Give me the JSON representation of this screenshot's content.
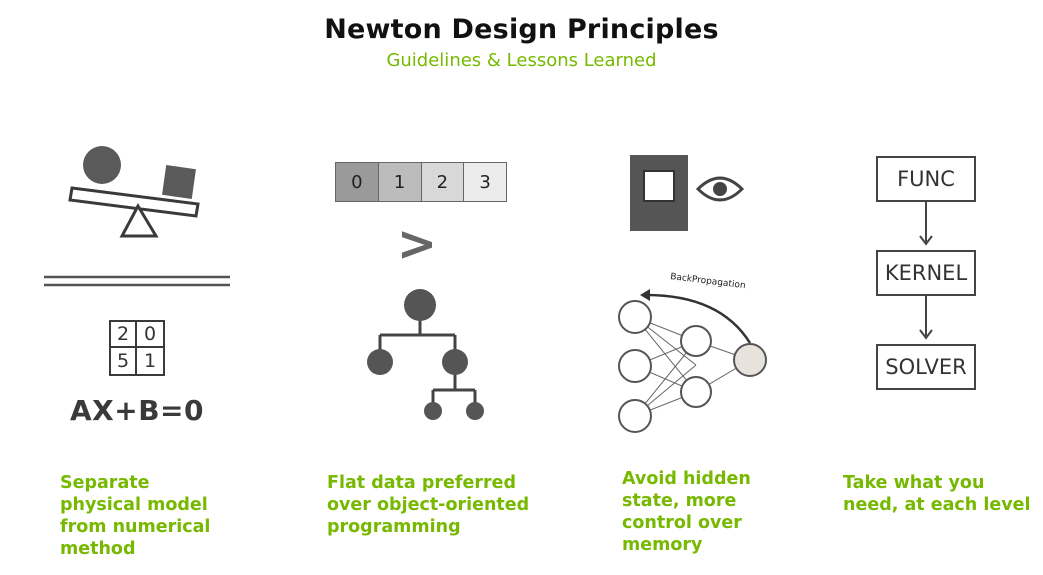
{
  "title": "Newton Design Principles",
  "subtitle": "Guidelines & Lessons Learned",
  "accent_color": "#76b900",
  "panels": [
    {
      "caption_lines": [
        "Separate",
        "physical model",
        "from numerical",
        "method"
      ],
      "matrix": [
        "2",
        "0",
        "5",
        "1"
      ],
      "equation": "AX+B=0",
      "icons": [
        "balance-scale-icon",
        "matrix-icon"
      ]
    },
    {
      "caption_lines": [
        "Flat data preferred",
        "over object-oriented",
        "programming"
      ],
      "array_cells": [
        "0",
        "1",
        "2",
        "3"
      ],
      "comparison_symbol": ">",
      "icons": [
        "array-icon",
        "greater-than-icon",
        "tree-icon"
      ]
    },
    {
      "caption_lines": [
        "Avoid hidden",
        "state, more",
        "control over",
        "memory"
      ],
      "network_label": "BackPropagation",
      "icons": [
        "memory-box-icon",
        "eye-icon",
        "neural-network-icon"
      ]
    },
    {
      "caption_lines": [
        "Take what you",
        "need, at each level"
      ],
      "flow_steps": [
        "FUNC",
        "KERNEL",
        "SOLVER"
      ],
      "icons": [
        "flowchart-icon",
        "arrow-down-icon"
      ]
    }
  ]
}
